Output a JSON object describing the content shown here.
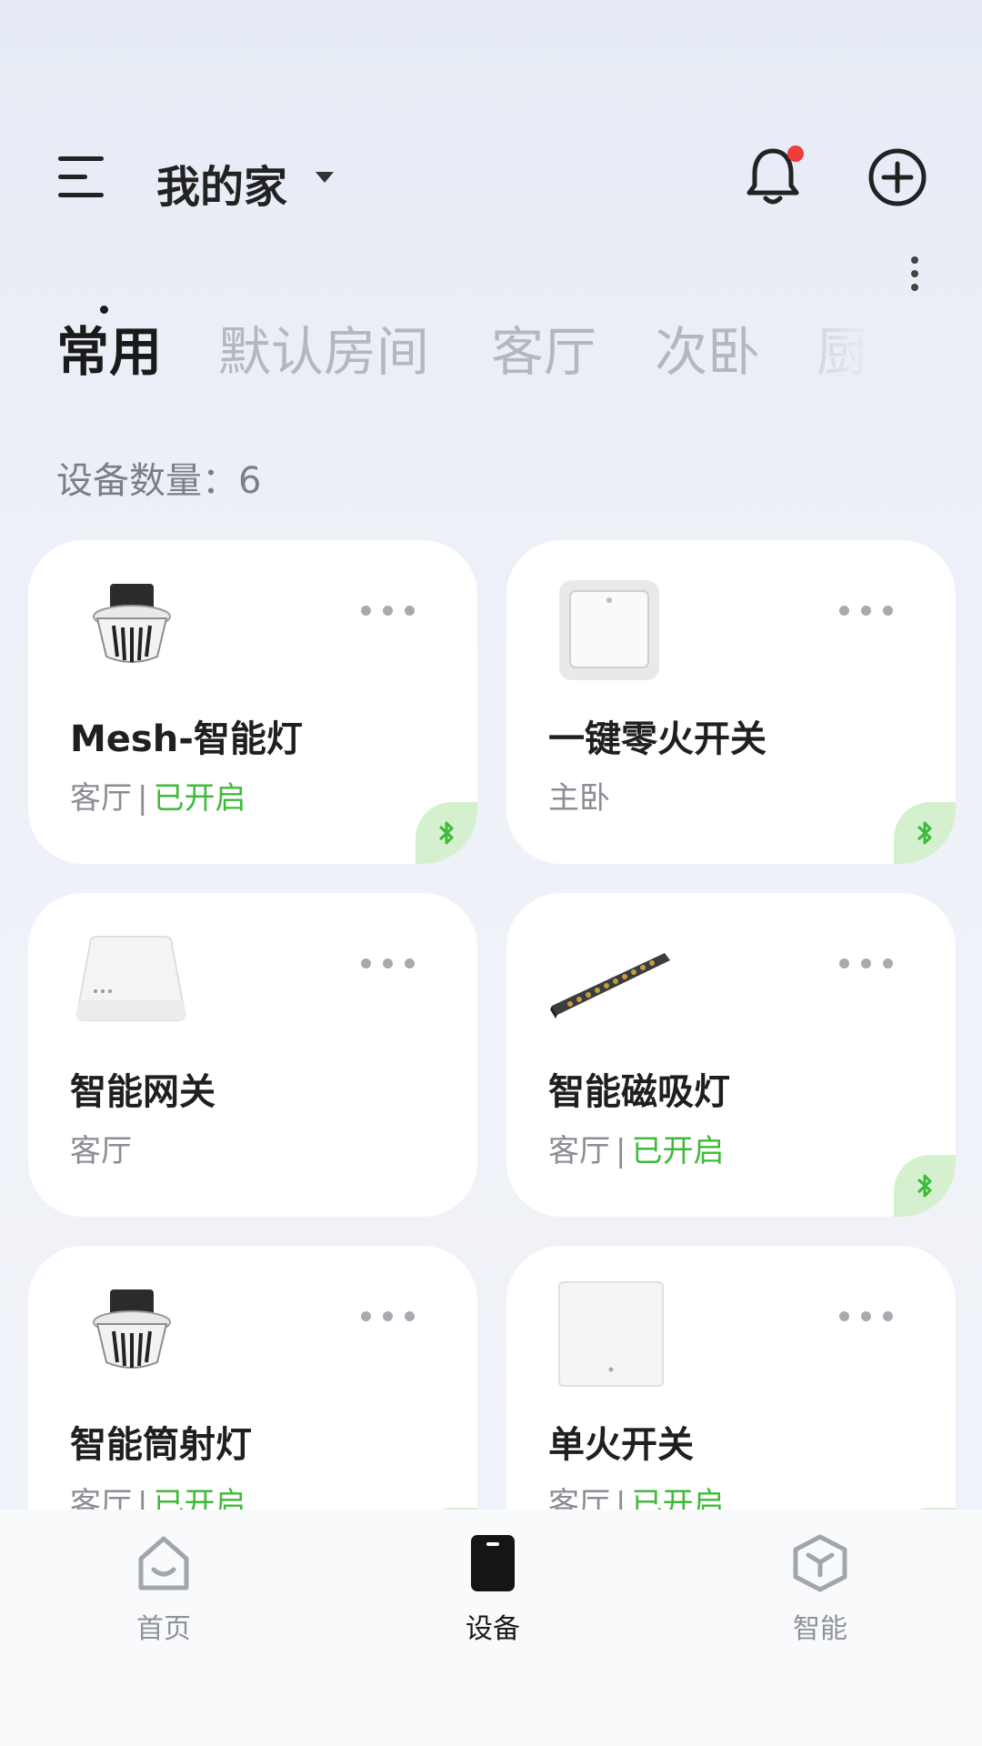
{
  "header": {
    "home_name": "我的家",
    "has_notification": true,
    "icons": {
      "menu": "menu-icon",
      "bell": "bell-icon",
      "add": "add-circle-icon",
      "more": "more-vertical-icon"
    }
  },
  "tabs": [
    {
      "label": "常用",
      "active": true
    },
    {
      "label": "默认房间",
      "active": false
    },
    {
      "label": "客厅",
      "active": false
    },
    {
      "label": "次卧",
      "active": false
    },
    {
      "label": "厨",
      "active": false
    }
  ],
  "device_count": {
    "label": "设备数量：",
    "value": "6"
  },
  "devices": [
    {
      "name": "Mesh-智能灯",
      "room": "客厅",
      "status": "已开启",
      "bluetooth": true,
      "icon": "downlight-icon"
    },
    {
      "name": "一键零火开关",
      "room": "主卧",
      "status": "",
      "bluetooth": true,
      "icon": "wall-switch-icon"
    },
    {
      "name": "智能网关",
      "room": "客厅",
      "status": "",
      "bluetooth": false,
      "icon": "gateway-icon"
    },
    {
      "name": "智能磁吸灯",
      "room": "客厅",
      "status": "已开启",
      "bluetooth": true,
      "icon": "magnetic-light-icon"
    },
    {
      "name": "智能筒射灯",
      "room": "客厅",
      "status": "已开启",
      "bluetooth": true,
      "icon": "downlight-icon"
    },
    {
      "name": "单火开关",
      "room": "客厅",
      "status": "已开启",
      "bluetooth": true,
      "icon": "panel-switch-icon"
    }
  ],
  "bottom_nav": [
    {
      "label": "首页",
      "icon": "home-icon",
      "active": false
    },
    {
      "label": "设备",
      "icon": "device-icon",
      "active": true
    },
    {
      "label": "智能",
      "icon": "smart-cube-icon",
      "active": false
    }
  ],
  "colors": {
    "accent_green": "#3fba3a",
    "badge_bg": "#d4f0cf",
    "notification_red": "#f23b3b"
  }
}
